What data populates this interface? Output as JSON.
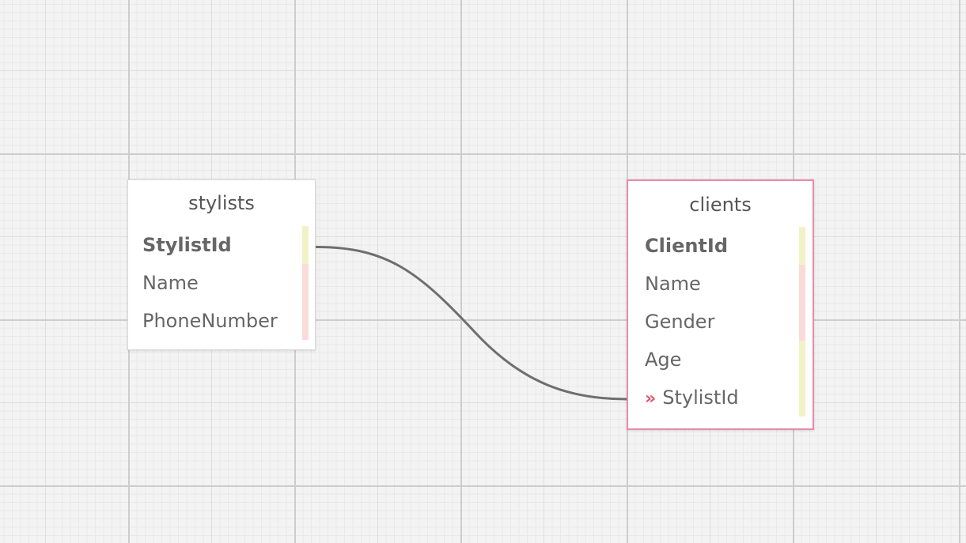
{
  "colors": {
    "canvas_background": "#f3f3f3",
    "table_border_selected": "#e88aa8",
    "relation_line": "#6e6e6e",
    "fk_marker": "#e0556e",
    "stripe_yellow": "#f1f3c6",
    "stripe_pink": "#fbdada"
  },
  "tables": {
    "stylists": {
      "name": "stylists",
      "selected": false,
      "columns": [
        {
          "name": "StylistId",
          "primary_key": true,
          "foreign_key": false,
          "stripe": "stripe_yellow"
        },
        {
          "name": "Name",
          "primary_key": false,
          "foreign_key": false,
          "stripe": "stripe_pink"
        },
        {
          "name": "PhoneNumber",
          "primary_key": false,
          "foreign_key": false,
          "stripe": "stripe_pink"
        }
      ]
    },
    "clients": {
      "name": "clients",
      "selected": true,
      "columns": [
        {
          "name": "ClientId",
          "primary_key": true,
          "foreign_key": false,
          "stripe": "stripe_yellow"
        },
        {
          "name": "Name",
          "primary_key": false,
          "foreign_key": false,
          "stripe": "stripe_pink"
        },
        {
          "name": "Gender",
          "primary_key": false,
          "foreign_key": false,
          "stripe": "stripe_pink"
        },
        {
          "name": "Age",
          "primary_key": false,
          "foreign_key": false,
          "stripe": "stripe_yellow"
        },
        {
          "name": "StylistId",
          "primary_key": false,
          "foreign_key": true,
          "fk_marker": "»",
          "stripe": "stripe_yellow"
        }
      ]
    }
  },
  "relations": [
    {
      "from_table": "stylists",
      "from_column": "StylistId",
      "to_table": "clients",
      "to_column": "StylistId"
    }
  ]
}
